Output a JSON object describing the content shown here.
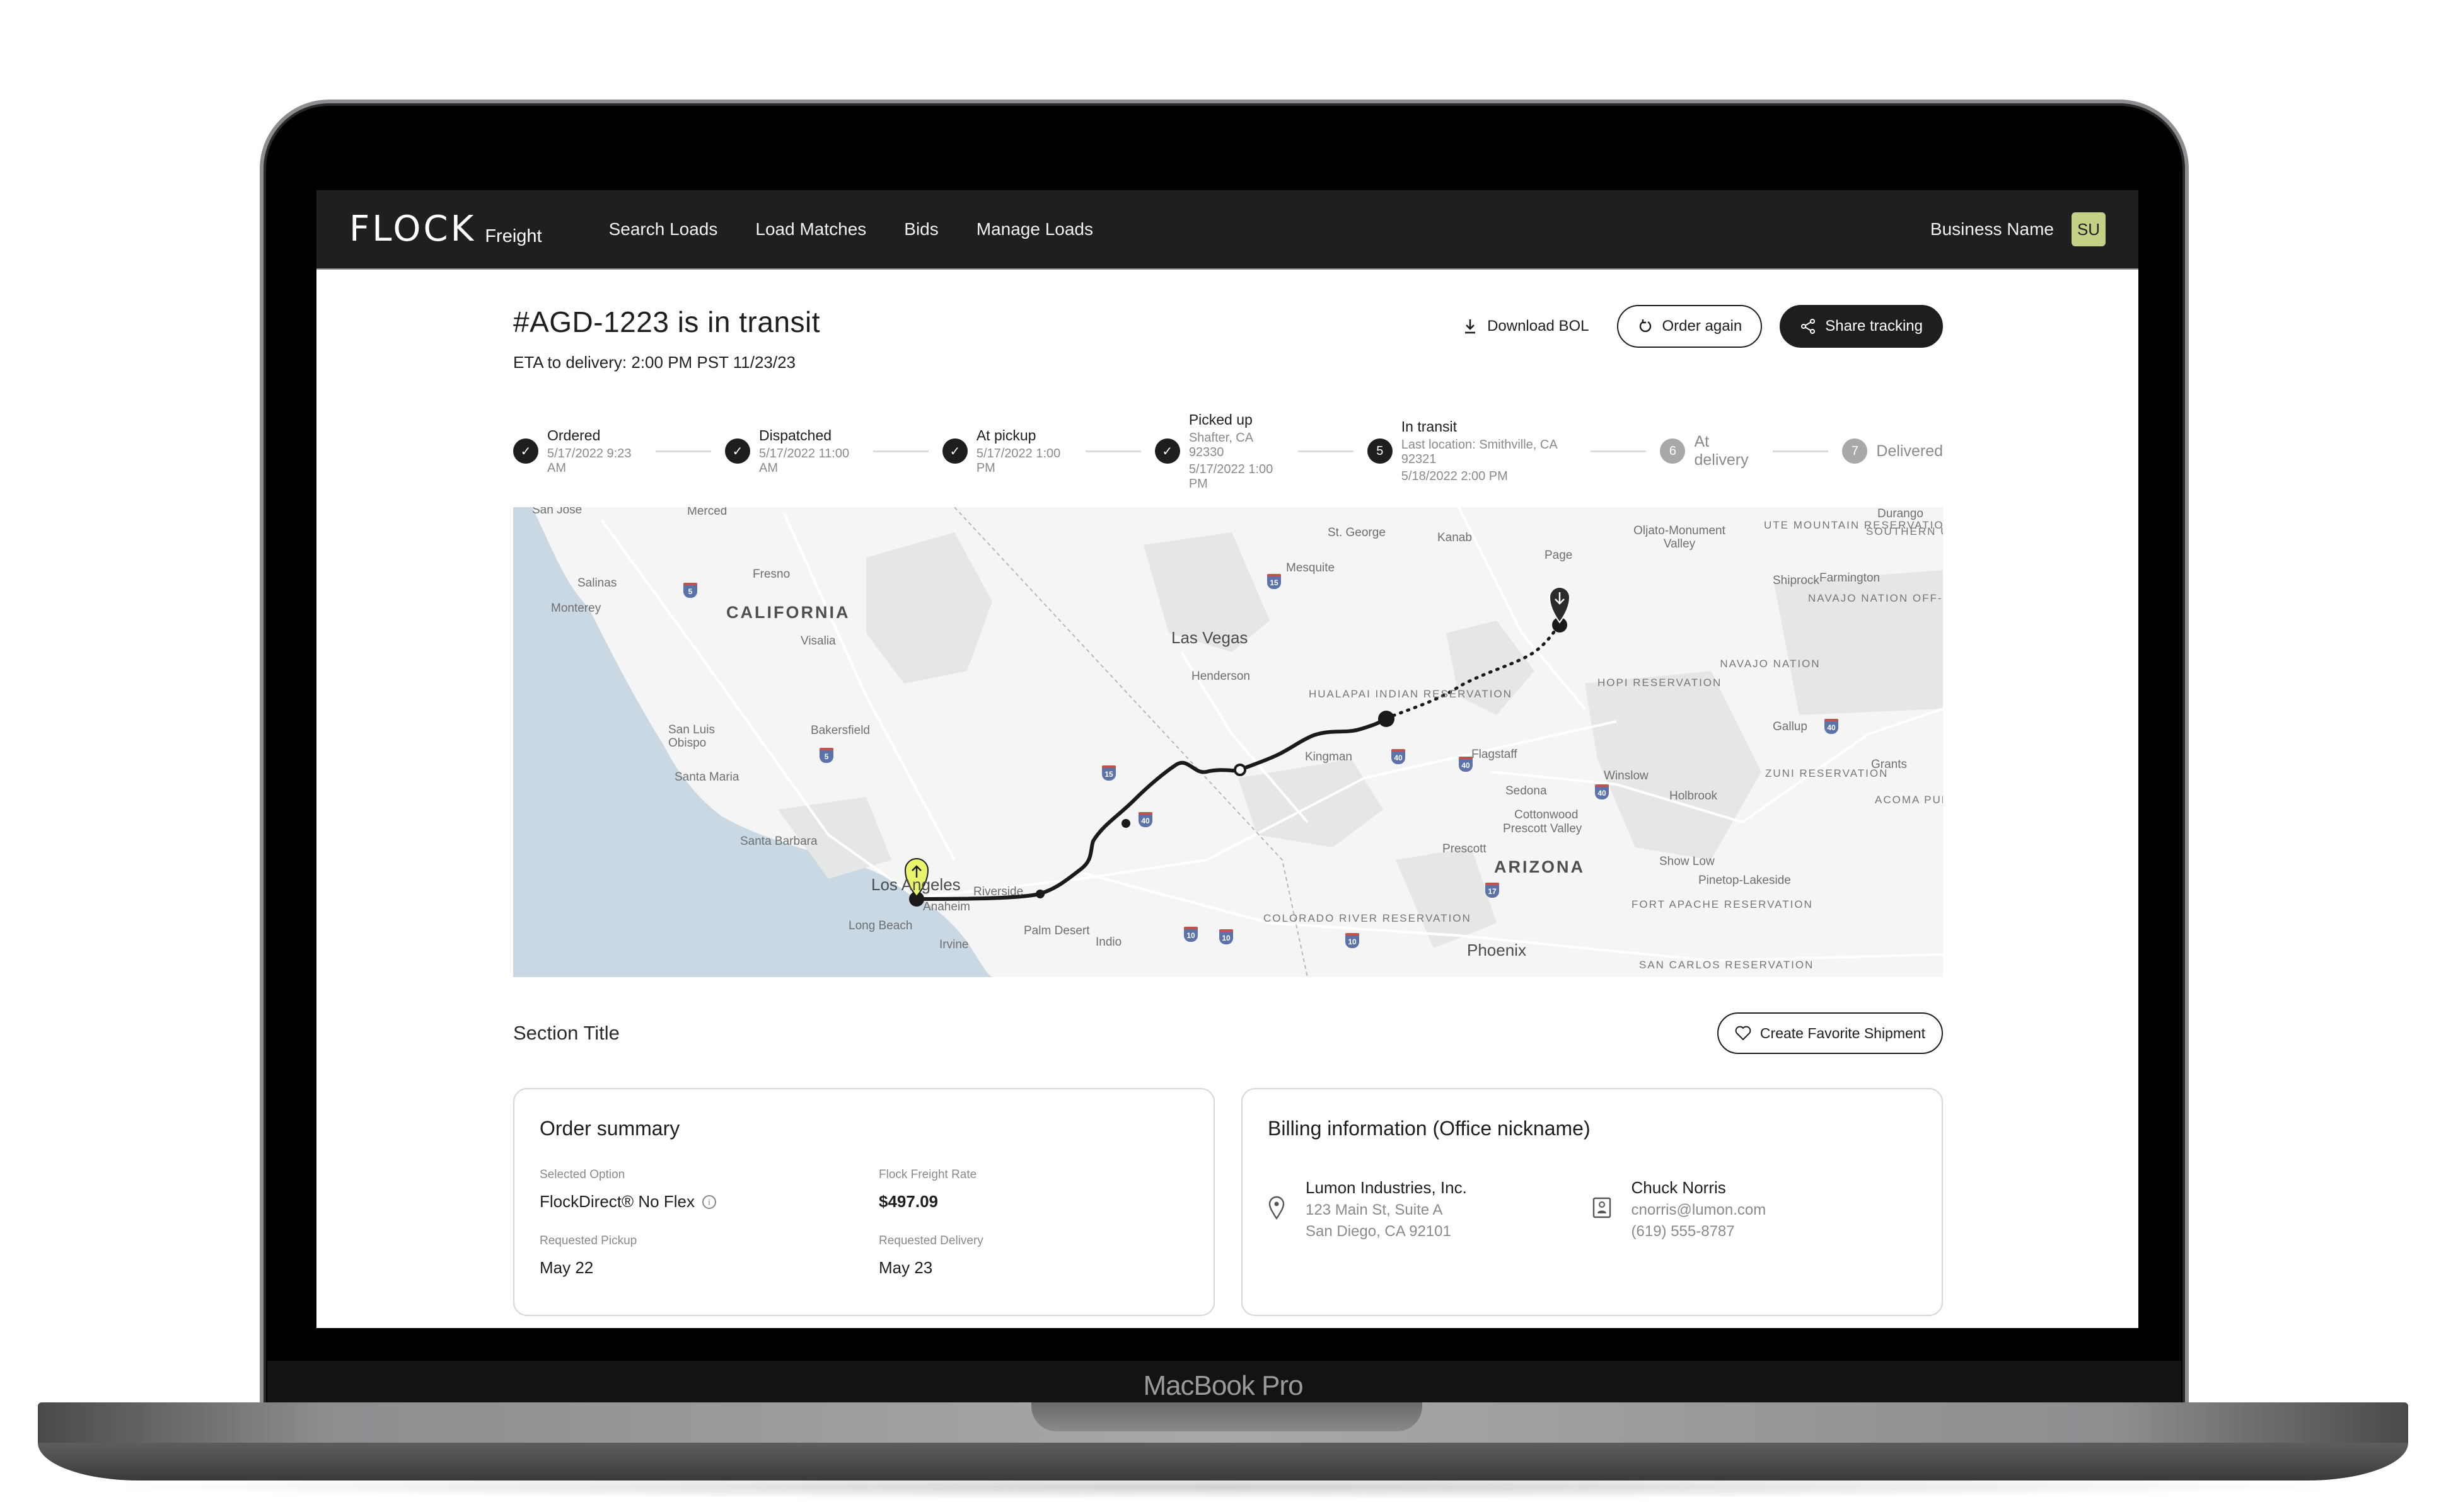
{
  "device": {
    "label": "MacBook Pro"
  },
  "nav": {
    "logo_mark": "FLOCK",
    "logo_sub": "Freight",
    "links": [
      "Search Loads",
      "Load Matches",
      "Bids",
      "Manage Loads"
    ],
    "business_name": "Business Name",
    "avatar_initials": "SU",
    "avatar_color": "#c5cf85"
  },
  "header": {
    "title": "#AGD-1223 is in transit",
    "eta": "ETA to delivery: 2:00 PM PST 11/23/23",
    "actions": {
      "download_bol": "Download BOL",
      "order_again": "Order again",
      "share_tracking": "Share tracking"
    }
  },
  "stepper": [
    {
      "label": "Ordered",
      "status": "complete",
      "lines": [
        "5/17/2022 9:23 AM"
      ]
    },
    {
      "label": "Dispatched",
      "status": "complete",
      "lines": [
        "5/17/2022 11:00 AM"
      ]
    },
    {
      "label": "At pickup",
      "status": "complete",
      "lines": [
        "5/17/2022 1:00 PM"
      ]
    },
    {
      "label": "Picked up",
      "status": "complete",
      "lines": [
        "Shafter, CA 92330",
        "5/17/2022 1:00 PM"
      ]
    },
    {
      "label": "In transit",
      "status": "current",
      "number": "5",
      "lines": [
        "Last location: Smithville, CA 92321",
        "5/18/2022 2:00 PM"
      ]
    },
    {
      "label": "At delivery",
      "status": "pending",
      "number": "6",
      "lines": []
    },
    {
      "label": "Delivered",
      "status": "pending",
      "number": "7",
      "lines": []
    }
  ],
  "map": {
    "origin_pin_color": "#e9f36b",
    "destination_pin_color": "#2b2b2b",
    "route_color": "#1a1a1a",
    "water_color": "#c9d8e3",
    "labels": {
      "states": [
        "CALIFORNIA",
        "ARIZONA"
      ],
      "cities_major": [
        "Las Vegas",
        "Los Angeles",
        "Phoenix"
      ],
      "cities": [
        "San Jose",
        "Merced",
        "Fresno",
        "Salinas",
        "Monterey",
        "Visalia",
        "Bakersfield",
        "San Luis Obispo",
        "Santa Maria",
        "Santa Barbara",
        "Riverside",
        "Anaheim",
        "Long Beach",
        "Irvine",
        "Palm Desert",
        "Indio",
        "Henderson",
        "Mesquite",
        "St. George",
        "Kanab",
        "Page",
        "Oljato-Monument Valley",
        "Durango",
        "Shiprock",
        "Farmington",
        "Gallup",
        "Grants",
        "Kingman",
        "Flagstaff",
        "Winslow",
        "Holbrook",
        "Sedona",
        "Cottonwood",
        "Prescott Valley",
        "Prescott",
        "Show Low",
        "Pinetop-Lakeside"
      ],
      "reservations": [
        "HUALAPAI INDIAN RESERVATION",
        "HOPI RESERVATION",
        "NAVAJO NATION",
        "NAVAJO NATION OFF-RESERVATION TRUST LAND",
        "UTE MOUNTAIN RESERVATION",
        "SOUTHERN UTE RESERVATION",
        "ZUNI RESERVATION",
        "ACOMA PUEBLO",
        "COLORADO RIVER RESERVATION",
        "FORT APACHE RESERVATION",
        "SAN CARLOS RESERVATION"
      ],
      "highways": [
        "5",
        "5",
        "15",
        "15",
        "40",
        "40",
        "40",
        "40",
        "40",
        "10",
        "10",
        "10",
        "17"
      ]
    }
  },
  "section": {
    "title": "Section Title",
    "favorite_button": "Create Favorite Shipment"
  },
  "order_summary": {
    "title": "Order summary",
    "fields": [
      {
        "label": "Selected Option",
        "value": "FlockDirect® No Flex"
      },
      {
        "label": "Flock Freight Rate",
        "value": "$497.09"
      },
      {
        "label": "Requested Pickup",
        "value": "May 22"
      },
      {
        "label": "Requested Delivery",
        "value": "May 23"
      }
    ]
  },
  "billing": {
    "title": "Billing information (Office nickname)",
    "company": "Lumon Industries, Inc.",
    "address_line1": "123 Main St, Suite A",
    "address_line2": "San Diego, CA 92101",
    "contact_name": "Chuck Norris",
    "contact_email": "cnorris@lumon.com",
    "contact_phone": "(619) 555-8787"
  }
}
